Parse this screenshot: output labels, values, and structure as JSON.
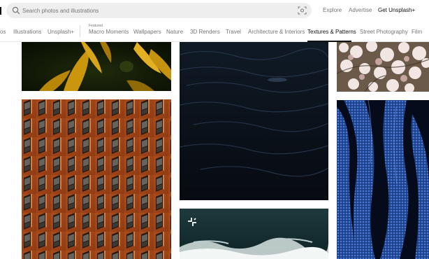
{
  "search": {
    "placeholder": "Search photos and illustrations"
  },
  "header_links": {
    "explore": "Explore",
    "advertise": "Advertise",
    "get_plus": "Get Unsplash+"
  },
  "topic_nav": {
    "featured_label": "Featured",
    "items": [
      {
        "label": "os",
        "active": false
      },
      {
        "label": "Illustrations",
        "active": false
      },
      {
        "label": "Unsplash+",
        "active": false
      },
      {
        "label": "Macro Moments",
        "active": false
      },
      {
        "label": "Wallpapers",
        "active": false
      },
      {
        "label": "Nature",
        "active": false
      },
      {
        "label": "3D Renders",
        "active": false
      },
      {
        "label": "Travel",
        "active": false
      },
      {
        "label": "Architecture & Interiors",
        "active": false
      },
      {
        "label": "Textures & Patterns",
        "active": true
      },
      {
        "label": "Street Photography",
        "active": false
      },
      {
        "label": "Film",
        "active": false
      }
    ]
  },
  "photos": [
    {
      "subject": "yellow-flower-petals"
    },
    {
      "subject": "red-brick-building-windows"
    },
    {
      "subject": "dark-water-ripples"
    },
    {
      "subject": "ocean-wave-with-logo"
    },
    {
      "subject": "cherry-blossom-tree"
    },
    {
      "subject": "blue-chainmail-fabric"
    }
  ],
  "colors": {
    "search_bg": "#eeeeee",
    "muted_text": "#767676",
    "active_text": "#111111"
  }
}
